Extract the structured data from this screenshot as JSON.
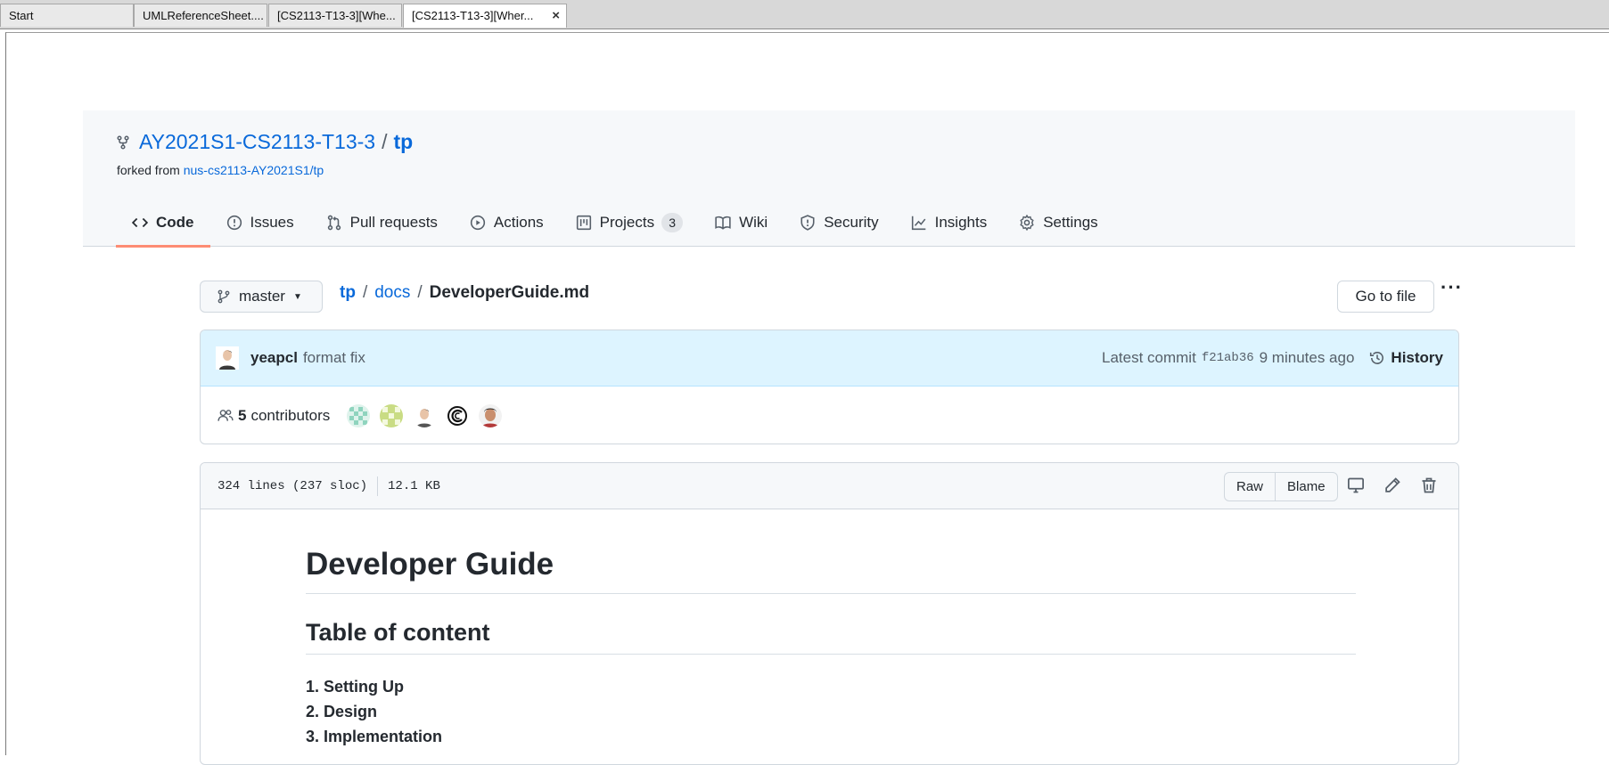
{
  "browser": {
    "tabs": [
      {
        "label": "Start"
      },
      {
        "label": "UMLReferenceSheet...."
      },
      {
        "label": "[CS2113-T13-3][Whe..."
      },
      {
        "label": "[CS2113-T13-3][Wher..."
      }
    ],
    "close_glyph": "×"
  },
  "repo": {
    "owner": "AY2021S1-CS2113-T13-3",
    "separator": "/",
    "name": "tp",
    "forked_prefix": "forked from",
    "forked_from": "nus-cs2113-AY2021S1/tp"
  },
  "nav": {
    "tabs": [
      {
        "label": "Code",
        "icon": "code-icon"
      },
      {
        "label": "Issues",
        "icon": "issue-icon"
      },
      {
        "label": "Pull requests",
        "icon": "pull-request-icon"
      },
      {
        "label": "Actions",
        "icon": "play-icon"
      },
      {
        "label": "Projects",
        "icon": "project-icon",
        "count": "3"
      },
      {
        "label": "Wiki",
        "icon": "book-icon"
      },
      {
        "label": "Security",
        "icon": "shield-icon"
      },
      {
        "label": "Insights",
        "icon": "graph-icon"
      },
      {
        "label": "Settings",
        "icon": "gear-icon"
      }
    ]
  },
  "file_nav": {
    "branch": "master",
    "path_repo": "tp",
    "path_dir": "docs",
    "path_file": "DeveloperGuide.md",
    "sep": "/",
    "goto_label": "Go to file",
    "more_label": "···"
  },
  "commit": {
    "author": "yeapcl",
    "message": "format fix",
    "latest_label": "Latest commit",
    "sha": "f21ab36",
    "time": "9 minutes ago",
    "history_label": "History"
  },
  "contributors": {
    "count": "5",
    "label": "contributors"
  },
  "file": {
    "lines": "324 lines (237 sloc)",
    "size": "12.1 KB",
    "raw_label": "Raw",
    "blame_label": "Blame"
  },
  "markdown": {
    "h1": "Developer Guide",
    "h2": "Table of content",
    "toc": [
      "1. Setting Up",
      "2. Design",
      "3. Implementation"
    ]
  },
  "colors": {
    "link": "#0969da",
    "selected_underline": "#fd8c73",
    "commit_bg": "#ddf4ff"
  }
}
